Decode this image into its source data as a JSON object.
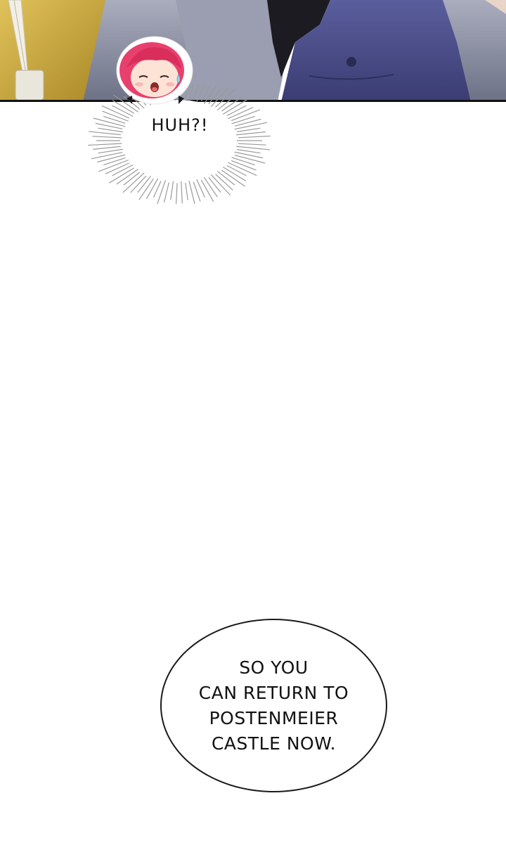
{
  "top_panel": {
    "colors": {
      "wall": "#c9a63c",
      "cloth_gray": "#8a8fa3",
      "jacket_navy": "#4a4d86",
      "hair_dark": "#1c1b22",
      "border": "#111111"
    }
  },
  "reaction": {
    "text": "HUH?!",
    "hair_color": "#e8406e"
  },
  "speech_bubble": {
    "lines": [
      "SO YOU",
      "CAN RETURN TO",
      "POSTENMEIER",
      "CASTLE NOW."
    ]
  }
}
